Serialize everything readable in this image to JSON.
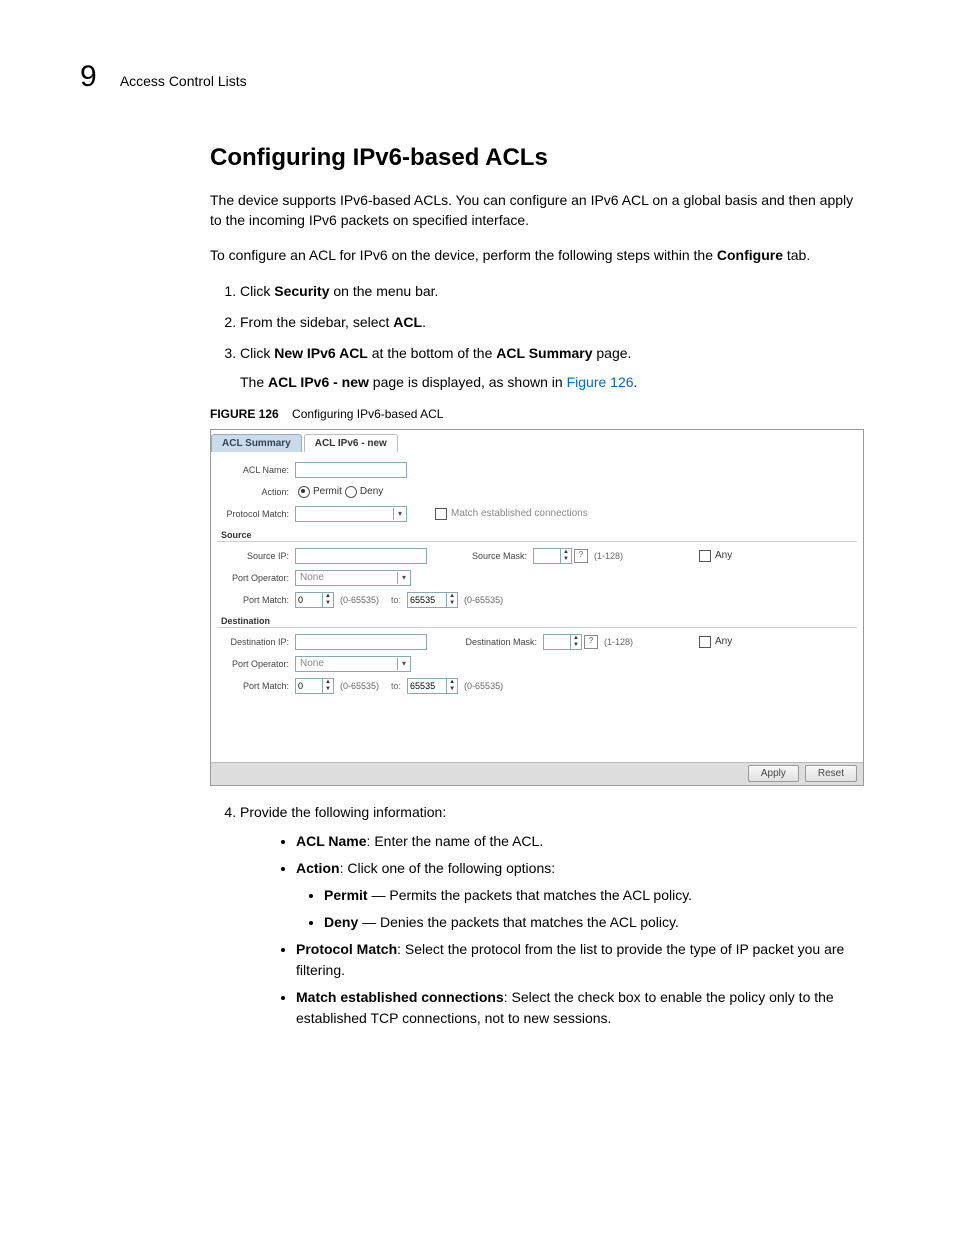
{
  "page": {
    "chapter_number": "9",
    "chapter_title": "Access Control Lists"
  },
  "section": {
    "heading": "Configuring IPv6-based ACLs",
    "intro1": "The device supports IPv6-based ACLs. You can configure an IPv6 ACL on a global basis and then apply to the incoming IPv6 packets on specified interface.",
    "intro2_pre": "To configure an ACL for IPv6 on the device, perform the following steps within the ",
    "intro2_bold": "Configure",
    "intro2_post": " tab."
  },
  "steps": {
    "s1_pre": "Click ",
    "s1_b": "Security",
    "s1_post": " on the menu bar.",
    "s2_pre": "From the sidebar, select ",
    "s2_b": "ACL",
    "s2_post": ".",
    "s3_pre": "Click ",
    "s3_b1": "New IPv6 ACL",
    "s3_mid": " at the bottom of the ",
    "s3_b2": "ACL Summary",
    "s3_post": " page.",
    "s3_note_pre": "The ",
    "s3_note_b": "ACL IPv6 - new",
    "s3_note_mid": " page is displayed, as shown in ",
    "s3_note_link": "Figure 126",
    "s3_note_post": ".",
    "s4": "Provide the following information:"
  },
  "figure": {
    "label": "FIGURE 126",
    "title": "Configuring IPv6-based ACL"
  },
  "shot": {
    "tab1": "ACL Summary",
    "tab2": "ACL IPv6 - new",
    "acl_name_label": "ACL Name:",
    "action_label": "Action:",
    "permit": "Permit",
    "deny": "Deny",
    "protocol_match_label": "Protocol Match:",
    "match_est": "Match established connections",
    "source_group": "Source",
    "source_ip_label": "Source IP:",
    "source_mask_label": "Source Mask:",
    "range_128": "(1-128)",
    "any": "Any",
    "port_operator_label": "Port Operator:",
    "port_operator_val": "None",
    "port_match_label": "Port Match:",
    "port_low": "0",
    "port_range_hint": "(0-65535)",
    "to": "to:",
    "port_high": "65535",
    "dest_group": "Destination",
    "dest_ip_label": "Destination IP:",
    "dest_mask_label": "Destination Mask:",
    "apply": "Apply",
    "reset": "Reset"
  },
  "bullets": {
    "b1_b": "ACL Name",
    "b1": ": Enter the name of the ACL.",
    "b2_b": "Action",
    "b2": ": Click one of the following options:",
    "b2a_b": "Permit",
    "b2a": " — Permits the packets that matches the ACL policy.",
    "b2b_b": "Deny",
    "b2b": " — Denies the packets that matches the ACL policy.",
    "b3_b": "Protocol Match",
    "b3": ": Select the protocol from the list to provide the type of IP packet you are filtering.",
    "b4_b": "Match established connections",
    "b4": ": Select the check box to enable the policy only to the established TCP connections, not to new sessions."
  }
}
